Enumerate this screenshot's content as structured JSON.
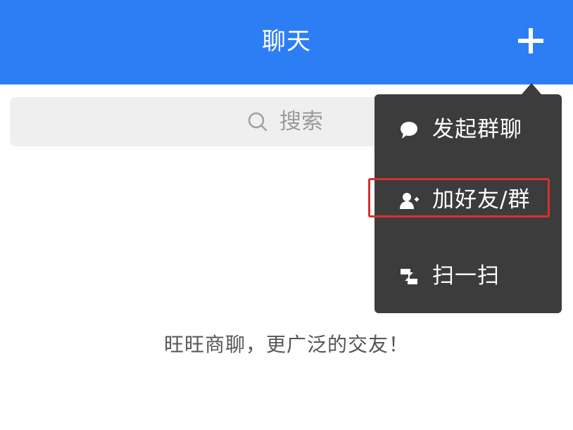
{
  "header": {
    "title": "聊天",
    "add_icon": "plus-icon"
  },
  "search": {
    "placeholder": "搜索",
    "icon": "search-icon"
  },
  "menu": {
    "items": [
      {
        "label": "发起群聊",
        "icon": "chat-bubble-icon"
      },
      {
        "label": "加好友/群",
        "icon": "add-user-icon",
        "highlighted": true
      },
      {
        "label": "扫一扫",
        "icon": "scan-icon"
      }
    ]
  },
  "empty_state": {
    "text": "旺旺商聊，更广泛的交友！"
  },
  "colors": {
    "header": "#2d7ef5",
    "menu_background": "#3c3c3c",
    "highlight": "#d9302c",
    "search_background": "#efefef"
  }
}
